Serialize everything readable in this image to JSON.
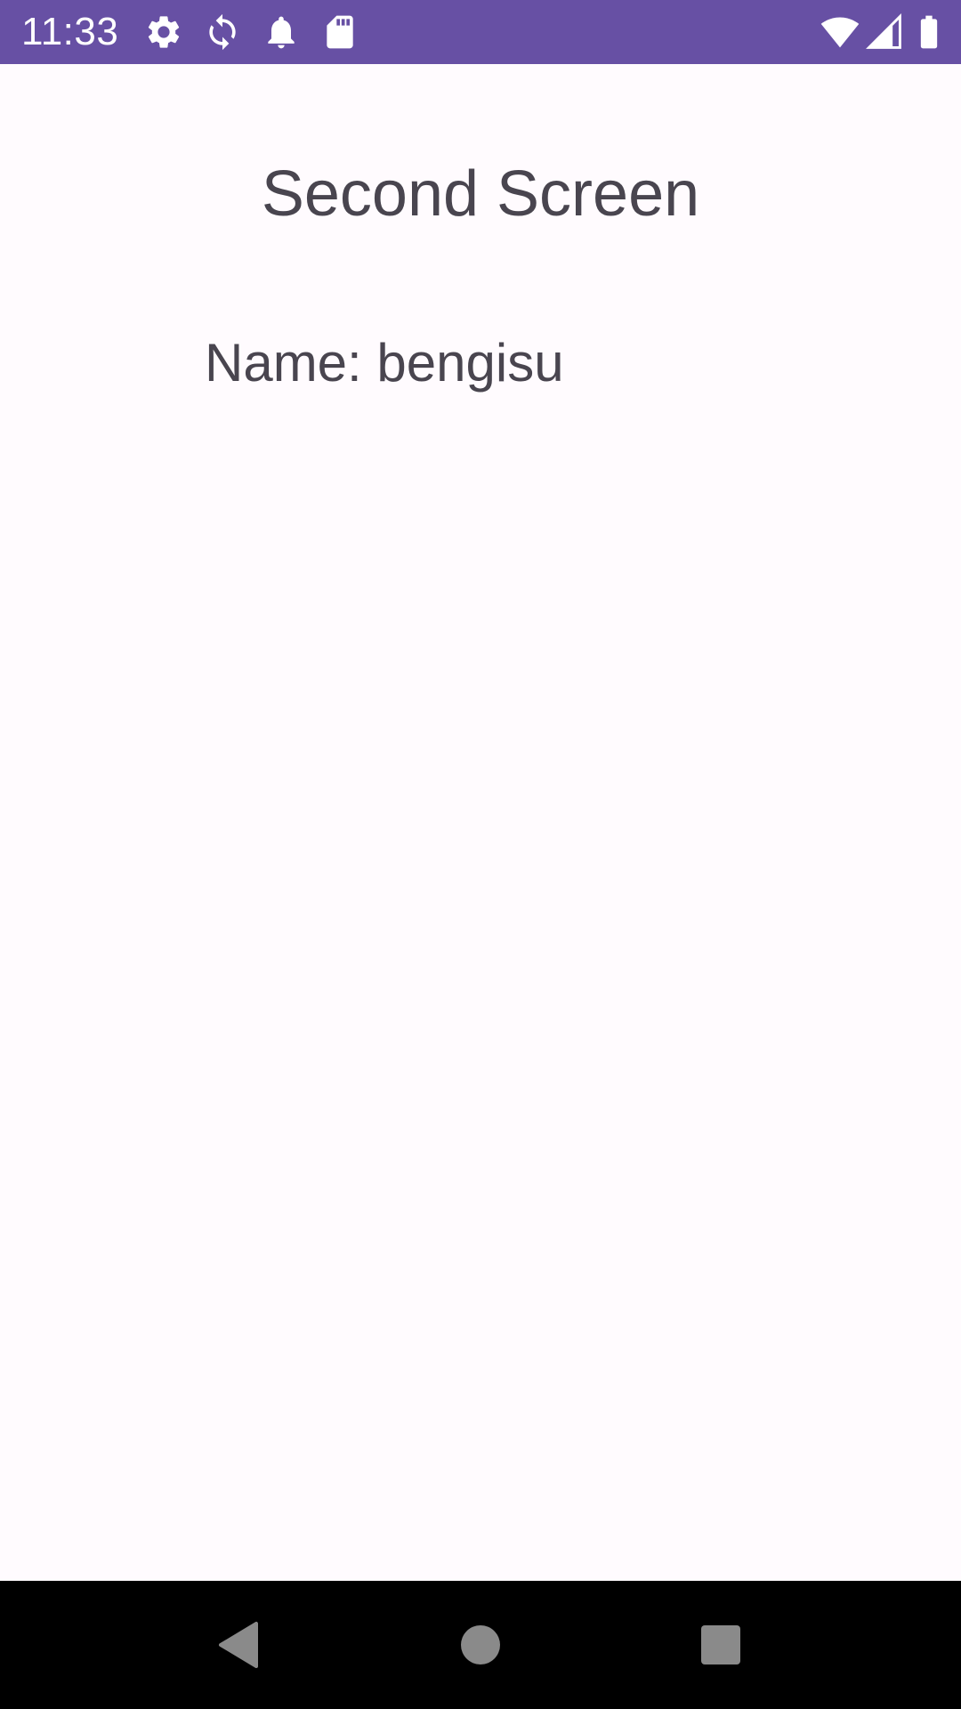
{
  "status_bar": {
    "time": "11:33",
    "background_color": "#6750A4",
    "left_icons": [
      "settings-gear-icon",
      "sync-icon",
      "notification-bell-icon",
      "sd-card-icon"
    ],
    "right_icons": [
      "wifi-icon",
      "cell-signal-icon",
      "battery-icon"
    ]
  },
  "screen": {
    "title": "Second Screen",
    "name_text": "Name: bengisu",
    "background_color": "#FFFBFE",
    "text_color": "#49454F"
  },
  "nav_bar": {
    "buttons": [
      "back-icon",
      "home-icon",
      "recents-icon"
    ],
    "icon_color": "#8A8A8A"
  }
}
